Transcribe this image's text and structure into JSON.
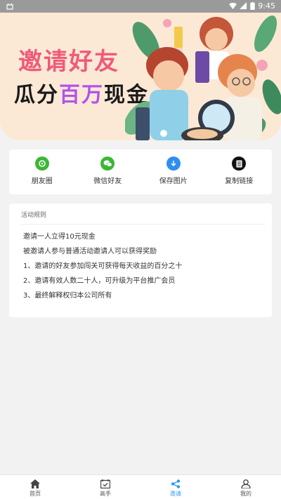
{
  "status_bar": {
    "time": "9:45"
  },
  "banner": {
    "title": "邀请好友",
    "subtitle_prefix": "瓜分",
    "subtitle_highlight": "百万",
    "subtitle_suffix": "现金"
  },
  "share": {
    "items": [
      {
        "label": "朋友圈",
        "icon": "moments-icon",
        "color": "#3cb734"
      },
      {
        "label": "微信好友",
        "icon": "wechat-icon",
        "color": "#3cb734"
      },
      {
        "label": "保存图片",
        "icon": "download-icon",
        "color": "#2f8ef0"
      },
      {
        "label": "复制链接",
        "icon": "copy-link-icon",
        "color": "#111111"
      }
    ]
  },
  "rules": {
    "title": "活动规则",
    "items": [
      "邀请一人立得10元现金",
      "被邀请人参与普通活动邀请人可以获得奖励",
      "1、邀请的好友参加闯关可获得每天收益的百分之十",
      "2、邀请有效人数二十人，可升级为平台推广会员",
      "3、最终解释权归本公司所有"
    ]
  },
  "tabbar": {
    "active_color": "#2f9bf0",
    "tabs": [
      {
        "label": "首页",
        "icon": "home-icon",
        "active": false
      },
      {
        "label": "高手",
        "icon": "calendar-check-icon",
        "active": false
      },
      {
        "label": "邀请",
        "icon": "share-icon",
        "active": true
      },
      {
        "label": "我的",
        "icon": "profile-icon",
        "active": false
      }
    ]
  }
}
